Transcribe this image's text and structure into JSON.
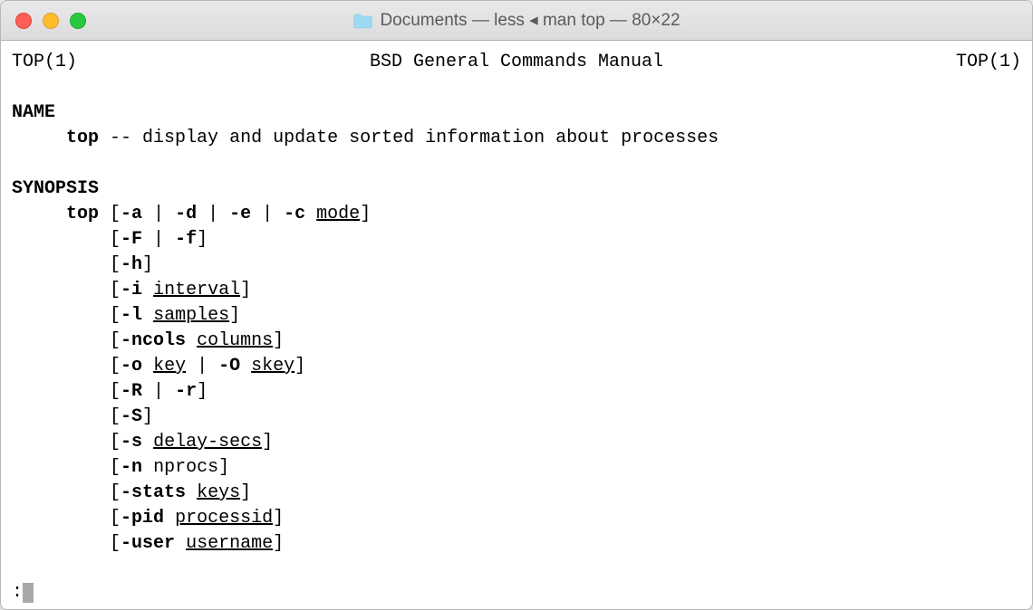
{
  "window": {
    "title": "Documents — less ◂ man top — 80×22"
  },
  "manpage": {
    "header_left": "TOP(1)",
    "header_center": "BSD General Commands Manual",
    "header_right": "TOP(1)",
    "sections": {
      "name_label": "NAME",
      "name_cmd": "top",
      "name_dash": " -- ",
      "name_desc": "display and update sorted information about processes",
      "synopsis_label": "SYNOPSIS",
      "syn_cmd": "top",
      "options": [
        {
          "pre": " [",
          "flags": [
            {
              "b": "-a"
            },
            {
              "t": " | "
            },
            {
              "b": "-d"
            },
            {
              "t": " | "
            },
            {
              "b": "-e"
            },
            {
              "t": " | "
            },
            {
              "b": "-c"
            },
            {
              "t": " "
            },
            {
              "u": "mode"
            }
          ],
          "post": "]"
        },
        {
          "pre": "[",
          "flags": [
            {
              "b": "-F"
            },
            {
              "t": " | "
            },
            {
              "b": "-f"
            }
          ],
          "post": "]"
        },
        {
          "pre": "[",
          "flags": [
            {
              "b": "-h"
            }
          ],
          "post": "]"
        },
        {
          "pre": "[",
          "flags": [
            {
              "b": "-i"
            },
            {
              "t": " "
            },
            {
              "u": "interval"
            }
          ],
          "post": "]"
        },
        {
          "pre": "[",
          "flags": [
            {
              "b": "-l"
            },
            {
              "t": " "
            },
            {
              "u": "samples"
            }
          ],
          "post": "]"
        },
        {
          "pre": "[",
          "flags": [
            {
              "b": "-ncols"
            },
            {
              "t": " "
            },
            {
              "u": "columns"
            }
          ],
          "post": "]"
        },
        {
          "pre": "[",
          "flags": [
            {
              "b": "-o"
            },
            {
              "t": " "
            },
            {
              "u": "key"
            },
            {
              "t": " | "
            },
            {
              "b": "-O"
            },
            {
              "t": " "
            },
            {
              "u": "skey"
            }
          ],
          "post": "]"
        },
        {
          "pre": "[",
          "flags": [
            {
              "b": "-R"
            },
            {
              "t": " | "
            },
            {
              "b": "-r"
            }
          ],
          "post": "]"
        },
        {
          "pre": "[",
          "flags": [
            {
              "b": "-S"
            }
          ],
          "post": "]"
        },
        {
          "pre": "[",
          "flags": [
            {
              "b": "-s"
            },
            {
              "t": " "
            },
            {
              "u": "delay-secs"
            }
          ],
          "post": "]"
        },
        {
          "pre": "[",
          "flags": [
            {
              "b": "-n"
            },
            {
              "t": " "
            },
            {
              "t": "nprocs"
            }
          ],
          "post": "]"
        },
        {
          "pre": "[",
          "flags": [
            {
              "b": "-stats"
            },
            {
              "t": " "
            },
            {
              "u": "keys"
            }
          ],
          "post": "]"
        },
        {
          "pre": "[",
          "flags": [
            {
              "b": "-pid"
            },
            {
              "t": " "
            },
            {
              "u": "processid"
            }
          ],
          "post": "]"
        },
        {
          "pre": "[",
          "flags": [
            {
              "b": "-user"
            },
            {
              "t": " "
            },
            {
              "u": "username"
            }
          ],
          "post": "]"
        }
      ]
    },
    "prompt": ":"
  }
}
